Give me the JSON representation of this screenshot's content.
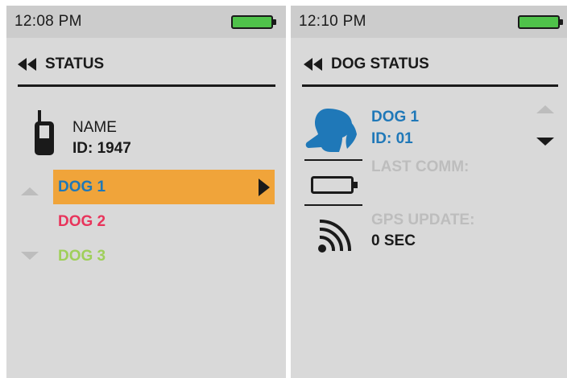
{
  "left_screen": {
    "time": "12:08 PM",
    "title": "STATUS",
    "device_name_label": "NAME",
    "device_id": "ID: 1947",
    "dogs": [
      {
        "label": "DOG 1",
        "color": "#1f78b8"
      },
      {
        "label": "DOG 2",
        "color": "#e8345b"
      },
      {
        "label": "DOG 3",
        "color": "#9fcf5a"
      }
    ],
    "selected_index": 0,
    "selected_bg": "#f0a43a"
  },
  "right_screen": {
    "time": "12:10 PM",
    "title": "DOG STATUS",
    "dog_name": "DOG 1",
    "dog_id": "ID: 01",
    "last_comm_label": "LAST COMM:",
    "gps_update_label": "GPS UPDATE:",
    "gps_update_value": "0 SEC"
  },
  "icons": {
    "back": "double-left-arrow-icon",
    "device": "handheld-device-icon",
    "dog": "dog-head-icon",
    "battery": "battery-icon",
    "signal": "signal-icon"
  },
  "colors": {
    "battery_fill": "#4fc24a",
    "dog_accent": "#1f78b8"
  }
}
